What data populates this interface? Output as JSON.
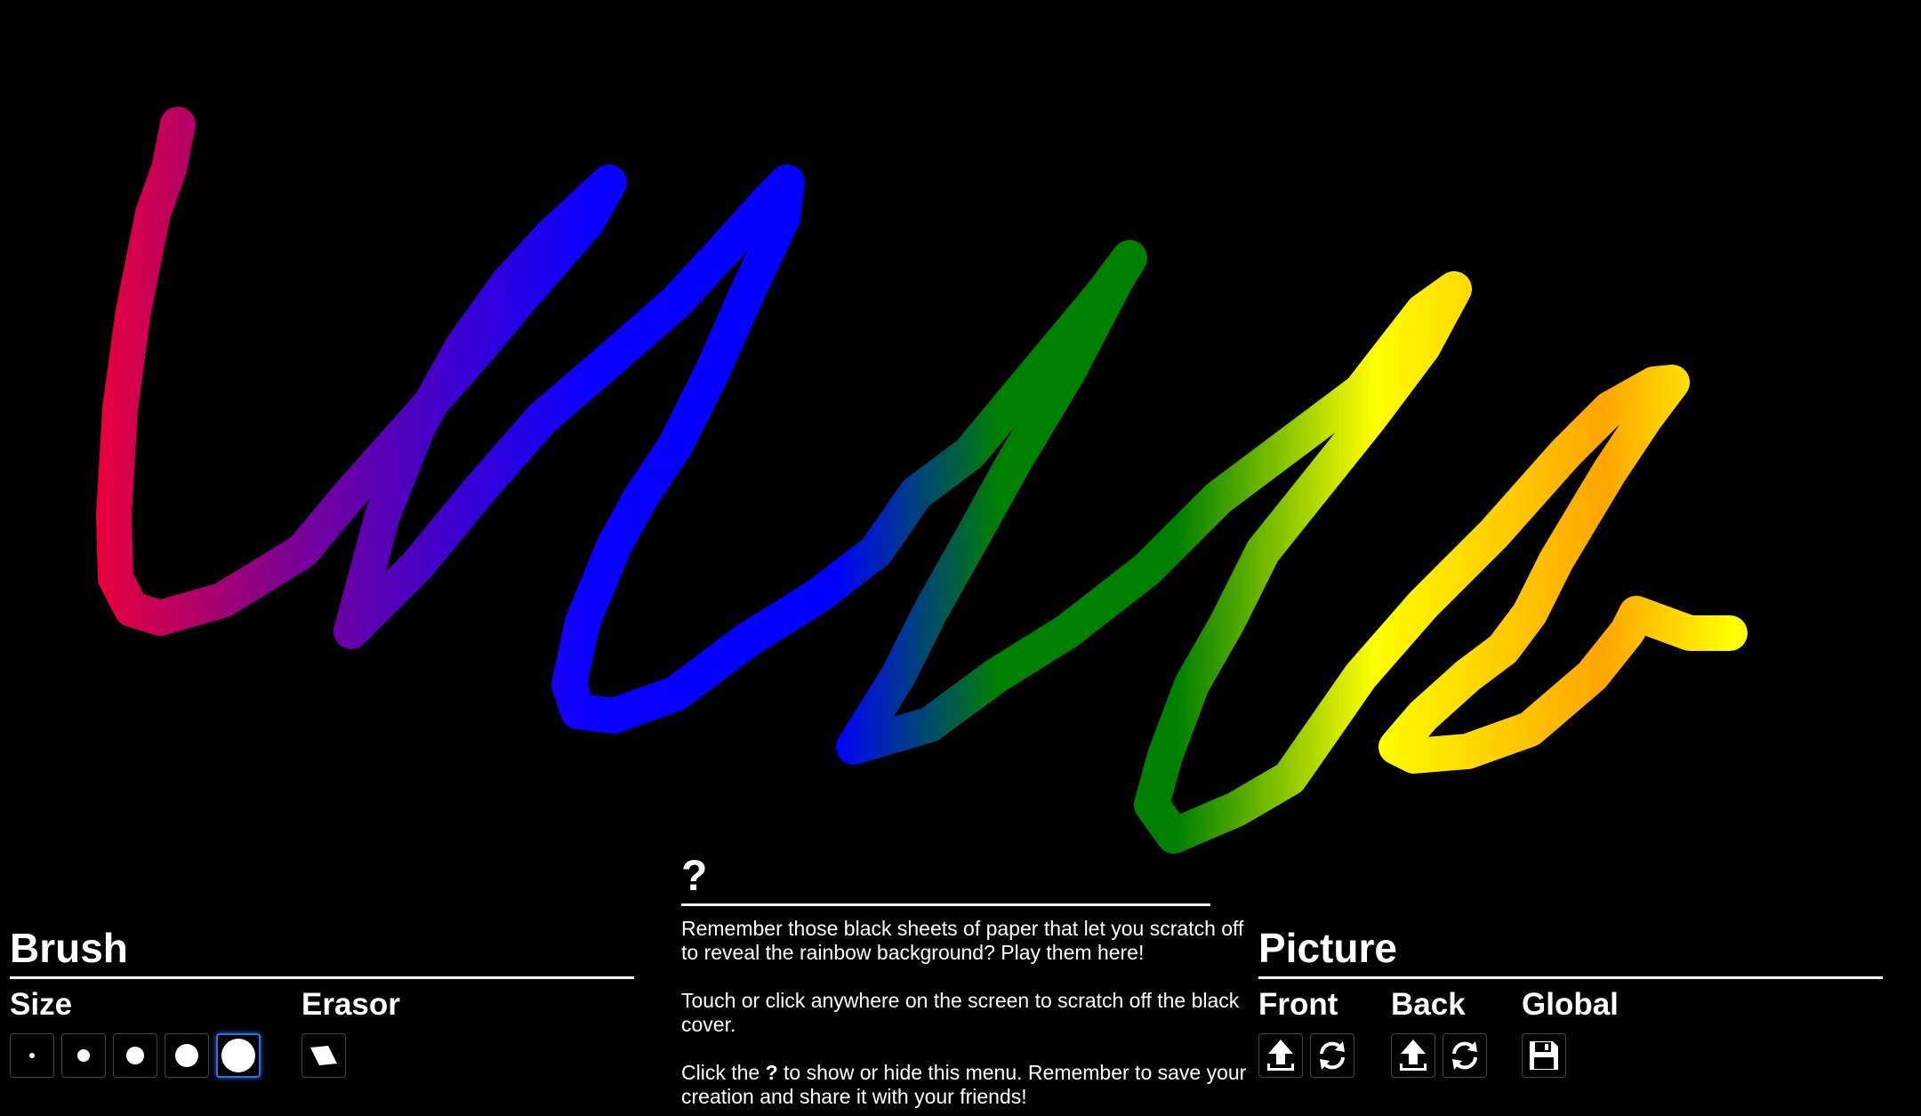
{
  "brush": {
    "title": "Brush",
    "size_title": "Size",
    "sizes": [
      {
        "name": "size-1",
        "selected": false
      },
      {
        "name": "size-2",
        "selected": false
      },
      {
        "name": "size-3",
        "selected": false
      },
      {
        "name": "size-4",
        "selected": false
      },
      {
        "name": "size-5",
        "selected": true
      }
    ],
    "eraser_title": "Erasor"
  },
  "help": {
    "toggle": "?",
    "p1": "Remember those black sheets of paper that let you scratch off to reveal the rainbow background? Play them here!",
    "p2": "Touch or click anywhere on the screen to scratch off the black cover.",
    "p3_before": "Click the ",
    "p3_bold": "?",
    "p3_after": " to show or hide this menu. Remember to save your creation and share it with your friends!"
  },
  "picture": {
    "title": "Picture",
    "front_title": "Front",
    "back_title": "Back",
    "global_title": "Global",
    "icons": {
      "upload": "upload-icon",
      "refresh": "refresh-icon",
      "save": "save-icon"
    }
  },
  "colors": {
    "background": "#000000",
    "rainbow": [
      "#e8003c",
      "#7a0096",
      "#0a00ff",
      "#0000ff",
      "#008000",
      "#ffff00",
      "#ffa500"
    ],
    "selected_border": "#2f6fe0"
  }
}
